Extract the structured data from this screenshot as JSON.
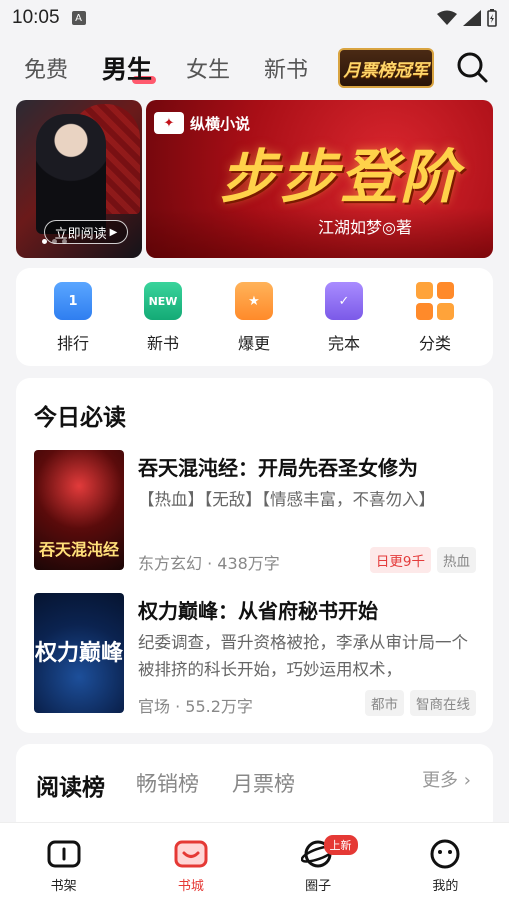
{
  "status_bar": {
    "time": "10:05",
    "notification_icon": "A"
  },
  "top_nav": {
    "tabs": [
      {
        "label": "免费"
      },
      {
        "label": "男生",
        "active": true
      },
      {
        "label": "女生"
      },
      {
        "label": "新书"
      }
    ],
    "promo_label": "月票榜冠军"
  },
  "banner": {
    "left": {
      "button_label": "立即阅读"
    },
    "right": {
      "brand": "纵横小说",
      "title": "步步登阶",
      "author": "江湖如梦◎著"
    }
  },
  "categories": [
    {
      "label": "排行",
      "icon": "rank-icon",
      "color": "#3d8bff"
    },
    {
      "label": "新书",
      "icon": "new-icon",
      "color": "#22c08a",
      "icon_text": "NEW"
    },
    {
      "label": "爆更",
      "icon": "fire-icon",
      "color": "#ff9a3a"
    },
    {
      "label": "完本",
      "icon": "check-icon",
      "color": "#8b6cf0"
    },
    {
      "label": "分类",
      "icon": "grid-icon",
      "color": "#ff8a2a"
    }
  ],
  "today": {
    "title": "今日必读",
    "books": [
      {
        "title": "吞天混沌经：开局先吞圣女修为",
        "description": "【热血】【无敌】【情感丰富，不喜勿入】",
        "meta": "东方玄幻 · 438万字",
        "cover_text": "吞天混沌经",
        "tags": [
          {
            "label": "日更9千",
            "style": "red"
          },
          {
            "label": "热血",
            "style": "gray"
          }
        ]
      },
      {
        "title": "权力巅峰：从省府秘书开始",
        "description": "纪委调查，晋升资格被抢，李承从审计局一个被排挤的科长开始，巧妙运用权术，",
        "meta": "官场 · 55.2万字",
        "cover_text": "权力巅峰",
        "tags": [
          {
            "label": "都市",
            "style": "gray"
          },
          {
            "label": "智商在线",
            "style": "gray"
          }
        ]
      }
    ]
  },
  "ranking": {
    "tabs": [
      {
        "label": "阅读榜",
        "active": true
      },
      {
        "label": "畅销榜"
      },
      {
        "label": "月票榜"
      }
    ],
    "more_label": "更多"
  },
  "bottom_nav": {
    "items": [
      {
        "label": "书架",
        "icon": "bookshelf-icon"
      },
      {
        "label": "书城",
        "icon": "bookstore-icon",
        "active": true
      },
      {
        "label": "圈子",
        "icon": "circle-icon",
        "badge": "上新"
      },
      {
        "label": "我的",
        "icon": "profile-icon"
      }
    ]
  },
  "colors": {
    "accent": "#e53935",
    "underline": "#ff5a6e",
    "background": "#f4f4f6"
  }
}
